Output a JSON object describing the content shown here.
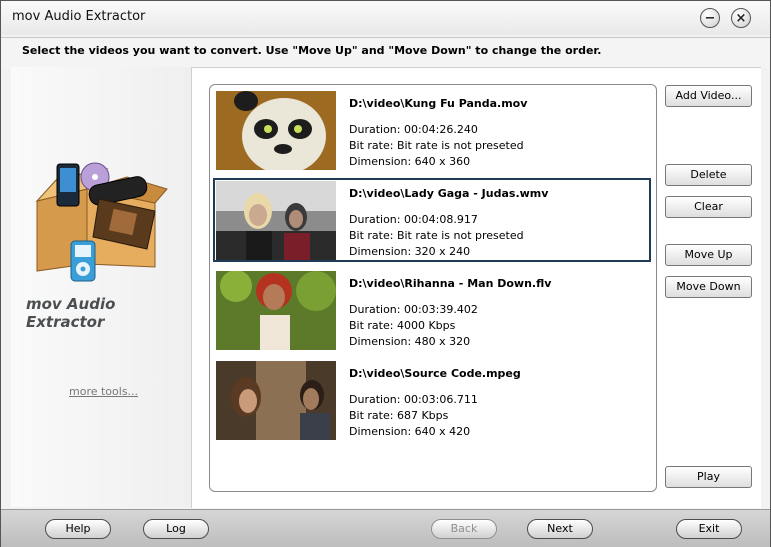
{
  "window": {
    "title": "mov Audio Extractor"
  },
  "instructions": "Select the videos you want to convert. Use \"Move Up\" and \"Move Down\" to change the order.",
  "sidebar": {
    "product_name": "mov Audio Extractor",
    "more_tools": "more tools..."
  },
  "videos": [
    {
      "path": "D:\\video\\Kung Fu Panda.mov",
      "duration": "Duration: 00:04:26.240",
      "bitrate": "Bit rate: Bit rate is not preseted",
      "dimension": "Dimension: 640 x 360",
      "selected": false
    },
    {
      "path": "D:\\video\\Lady Gaga - Judas.wmv",
      "duration": "Duration: 00:04:08.917",
      "bitrate": "Bit rate: Bit rate is not preseted",
      "dimension": "Dimension: 320 x 240",
      "selected": true
    },
    {
      "path": "D:\\video\\Rihanna - Man Down.flv",
      "duration": "Duration: 00:03:39.402",
      "bitrate": "Bit rate: 4000 Kbps",
      "dimension": "Dimension: 480 x 320",
      "selected": false
    },
    {
      "path": "D:\\video\\Source Code.mpeg",
      "duration": "Duration: 00:03:06.711",
      "bitrate": "Bit rate: 687 Kbps",
      "dimension": "Dimension: 640 x 420",
      "selected": false
    }
  ],
  "actions": {
    "add_video": "Add Video...",
    "delete": "Delete",
    "clear": "Clear",
    "move_up": "Move Up",
    "move_down": "Move Down",
    "play": "Play"
  },
  "footer": {
    "help": "Help",
    "log": "Log",
    "back": "Back",
    "next": "Next",
    "exit": "Exit"
  },
  "colors": {
    "selection_border": "#1f3b56",
    "link": "#777777"
  }
}
